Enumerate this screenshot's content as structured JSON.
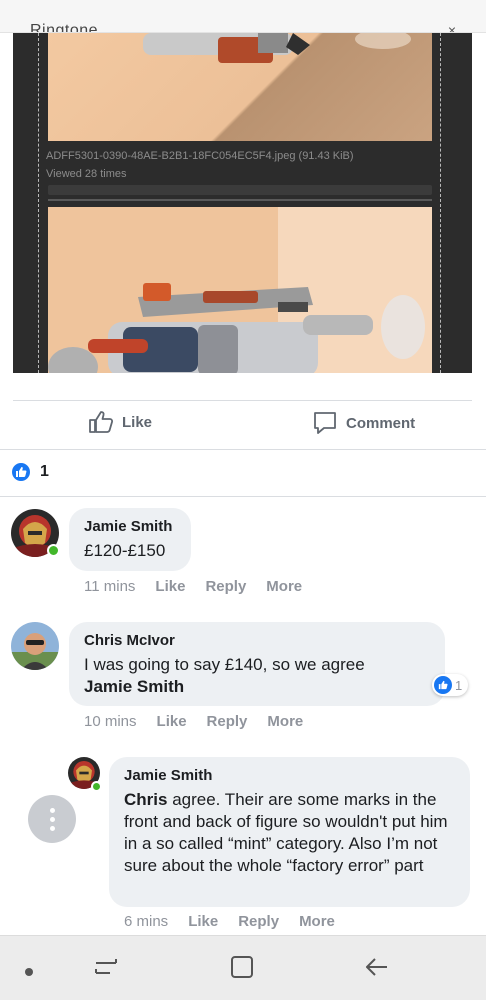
{
  "header": {
    "title": "Ringtone",
    "close_glyph": "×"
  },
  "photos": {
    "caption_filename": "ADFF5301-0390-48AE-B2B1-18FC054EC5F4.jpeg (91.43 KiB)",
    "caption_views": "Viewed 28 times"
  },
  "actions": {
    "like_label": "Like",
    "comment_label": "Comment"
  },
  "reactions": {
    "count": "1"
  },
  "comments": [
    {
      "author": "Jamie Smith",
      "text": "£120-£150",
      "time": "11 mins",
      "like": "Like",
      "reply": "Reply",
      "more": "More"
    },
    {
      "author": "Chris McIvor",
      "text": "I was going to say £140, so we agree",
      "mention": "Jamie Smith",
      "time": "10 mins",
      "like": "Like",
      "reply": "Reply",
      "more": "More",
      "reaction_count": "1"
    },
    {
      "author": "Jamie Smith",
      "mention": "Chris",
      "text": " agree. Their are some marks in the front and back of figure so wouldn't put him in a so called “mint” category. Also I’m not sure about the whole “factory error” part",
      "time": "6 mins",
      "like": "Like",
      "reply": "Reply",
      "more": "More"
    }
  ],
  "colors": {
    "accent": "#1877f2",
    "online": "#42b72a",
    "bubble": "#edf0f3",
    "muted": "#90949c"
  },
  "icons": [
    "thumbs-up-icon",
    "comment-icon",
    "more-dots-icon",
    "recent-apps-icon",
    "home-icon",
    "back-icon"
  ]
}
